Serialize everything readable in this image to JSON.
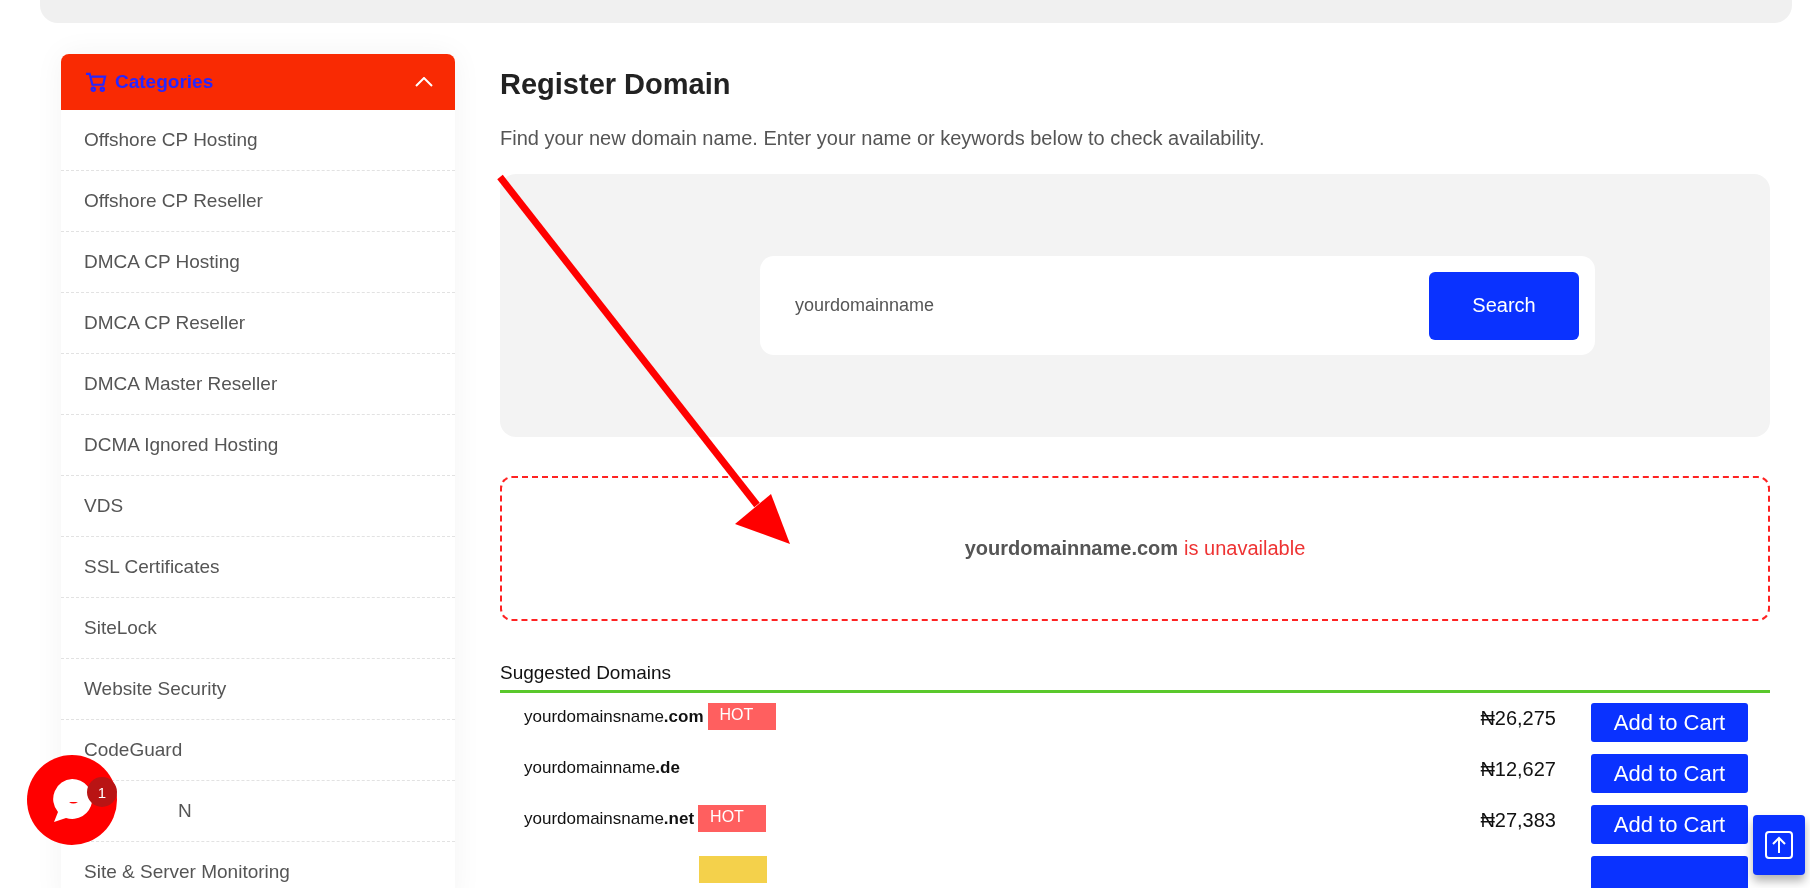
{
  "sidebar": {
    "title": "Categories",
    "expanded": true,
    "items": [
      {
        "label": "Offshore CP Hosting",
        "partly_covered": false
      },
      {
        "label": "Offshore CP Reseller",
        "partly_covered": false
      },
      {
        "label": "DMCA CP Hosting",
        "partly_covered": false
      },
      {
        "label": "DMCA CP Reseller",
        "partly_covered": false
      },
      {
        "label": "DMCA Master Reseller",
        "partly_covered": false
      },
      {
        "label": "DCMA Ignored Hosting",
        "partly_covered": false
      },
      {
        "label": "VDS",
        "partly_covered": false
      },
      {
        "label": "SSL Certificates",
        "partly_covered": false
      },
      {
        "label": "SiteLock",
        "partly_covered": false
      },
      {
        "label": "Website Security",
        "partly_covered": false
      },
      {
        "label": "CodeGuard",
        "partly_covered": false
      },
      {
        "label": "N",
        "partly_covered": true
      },
      {
        "label": "Site & Server Monitoring",
        "partly_covered": false
      }
    ]
  },
  "main": {
    "title": "Register Domain",
    "subtitle": "Find your new domain name. Enter your name or keywords below to check availability.",
    "search": {
      "value": "yourdomainname",
      "button": "Search"
    },
    "result": {
      "domain": "yourdomainname.com",
      "status": "is unavailable"
    },
    "suggestions": {
      "title": "Suggested Domains",
      "rows": [
        {
          "domain": "yourdomainsname**.com**",
          "tag": {
            "text": "HOT",
            "color": "#ff5f5f"
          },
          "price": "₦26,275",
          "button": "Add to Cart"
        },
        {
          "domain": "yourdomainname**.de**",
          "price": "₦12,627",
          "button": "Add to Cart"
        },
        {
          "domain": "yourdomainsname**.net**",
          "tag": {
            "text": "HOT",
            "color": "#ff5f5f"
          },
          "price": "₦27,383",
          "button": "Add to Cart"
        },
        {
          "tag": {
            "color": "#f4d14b"
          }
        }
      ]
    }
  },
  "chat": {
    "badge": "1"
  }
}
